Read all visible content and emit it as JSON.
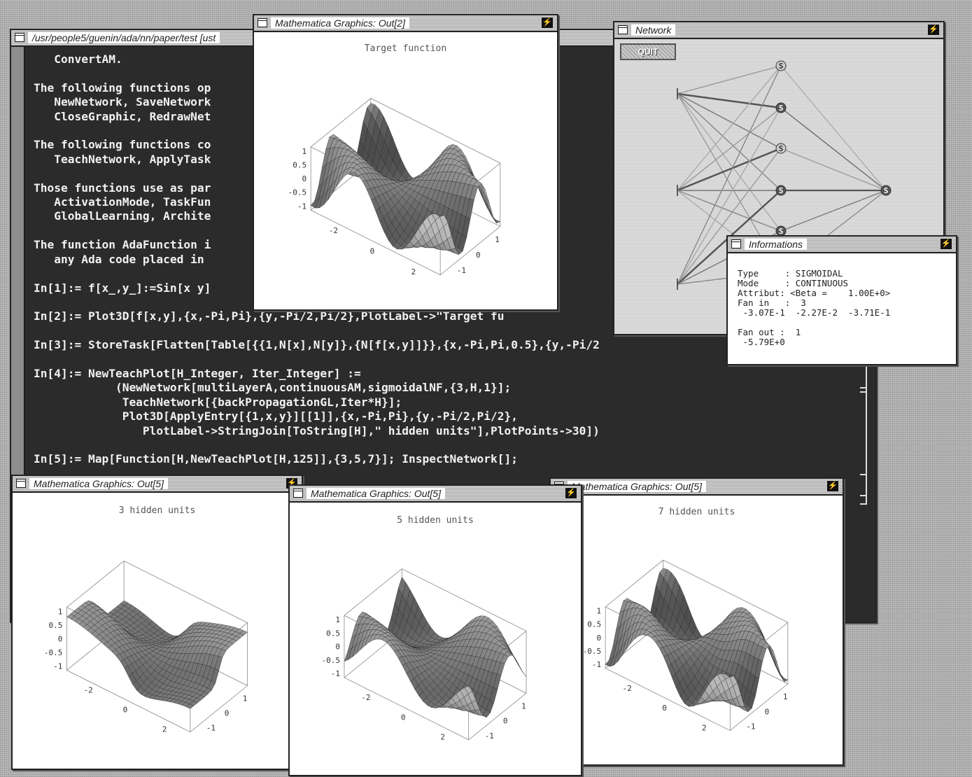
{
  "notebook": {
    "title": "/usr/people5/guenin/ada/nn/paper/test [ust",
    "lines": [
      "   ConvertAM.",
      "",
      "The following functions op                                        raphic,",
      "   NewNetwork, SaveNetwork",
      "   CloseGraphic, RedrawNet",
      "",
      "The following functions co",
      "   TeachNetwork, ApplyTask",
      "",
      "Those functions use as par",
      "   ActivationMode, TaskFun",
      "   GlobalLearning, Archite",
      "",
      "The function AdaFunction i                                        used t",
      "   any Ada code placed in",
      "",
      "In[1]:= f[x_,y_]:=Sin[x y]",
      "",
      "In[2]:= Plot3D[f[x,y],{x,-Pi,Pi},{y,-Pi/2,Pi/2},PlotLabel->\"Target fu",
      "",
      "In[3]:= StoreTask[Flatten[Table[{{1,N[x],N[y]},{N[f[x,y]]}},{x,-Pi,Pi,0.5},{y,-Pi/2",
      "",
      "In[4]:= NewTeachPlot[H_Integer, Iter_Integer] :=",
      "            (NewNetwork[multiLayerA,continuousAM,sigmoidalNF,{3,H,1}];",
      "             TeachNetwork[{backPropagationGL,Iter*H}];",
      "             Plot3D[ApplyEntry[{1,x,y}][[1]],{x,-Pi,Pi},{y,-Pi/2,Pi/2},",
      "                PlotLabel->StringJoin[ToString[H],\" hidden units\"],PlotPoints->30])",
      "",
      "In[5]:= Map[Function[H,NewTeachPlot[H,125]],{3,5,7}]; InspectNetwork[];"
    ]
  },
  "target_plot": {
    "title": "Mathematica Graphics: Out[2]",
    "label": "Target function"
  },
  "network": {
    "title": "Network",
    "quit_label": "QUIT",
    "node_label": "S"
  },
  "informations": {
    "title": "Informations",
    "lines": [
      "Type     : SIGMOIDAL",
      "Mode     : CONTINUOUS",
      "Attribut: <Beta =    1.00E+0>",
      "Fan in   :  3",
      " -3.07E-1  -2.27E-2  -3.71E-1",
      "",
      "Fan out :  1",
      " -5.79E+0"
    ]
  },
  "hidden_plots": [
    {
      "title": "Mathematica Graphics: Out[5]",
      "label": "3 hidden units"
    },
    {
      "title": "Mathematica Graphics: Out[5]",
      "label": "5 hidden units"
    },
    {
      "title": "Mathematica Graphics: Out[5]",
      "label": "7 hidden units"
    }
  ],
  "axis_ticks": {
    "z": [
      "1",
      "0.5",
      "0",
      "-0.5",
      "-1"
    ],
    "x": [
      "-2",
      "0",
      "2"
    ],
    "y": [
      "1",
      "0",
      "-1"
    ]
  }
}
